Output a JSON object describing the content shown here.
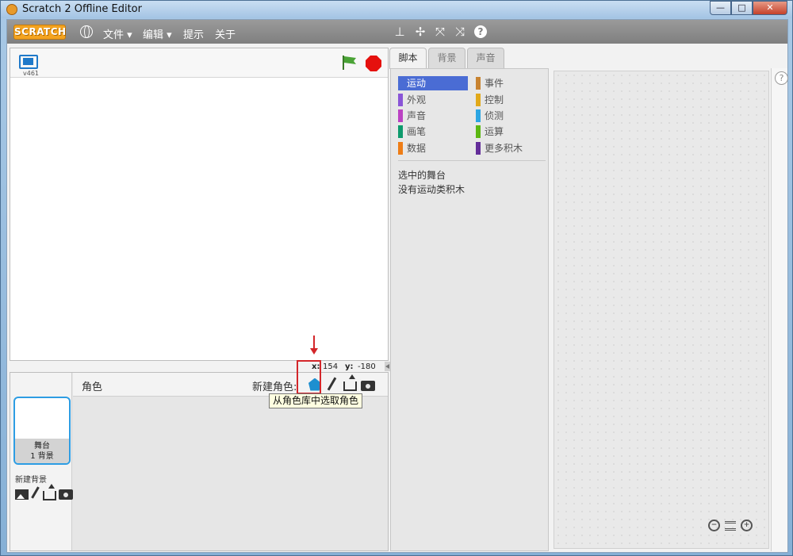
{
  "window": {
    "title": "Scratch 2 Offline Editor",
    "buttons": {
      "minimize": "—",
      "maximize": "□",
      "close": "✕"
    }
  },
  "menubar": {
    "logo": "SCRATCH",
    "items": [
      "文件 ▾",
      "编辑 ▾",
      "提示",
      "关于"
    ],
    "tools": [
      "stamp-icon",
      "cut-icon",
      "grow-icon",
      "shrink-icon",
      "help-icon"
    ],
    "help_label": "?"
  },
  "stage": {
    "version": "v461",
    "x_label": "x:",
    "x_value": "154",
    "y_label": "y:",
    "y_value": "-180"
  },
  "sprites": {
    "header": "角色",
    "new_sprite_label": "新建角色:",
    "tooltip": "从角色库中选取角色",
    "stage_thumb_name": "舞台",
    "stage_thumb_sub": "1 背景",
    "new_backdrop_label": "新建背景"
  },
  "tabs": [
    "脚本",
    "背景",
    "声音"
  ],
  "palette": {
    "categories_left": [
      {
        "label": "运动",
        "color": "#4a6cd4"
      },
      {
        "label": "外观",
        "color": "#8a55d7"
      },
      {
        "label": "声音",
        "color": "#bb42c3"
      },
      {
        "label": "画笔",
        "color": "#0e9a6c"
      },
      {
        "label": "数据",
        "color": "#ee7d16"
      }
    ],
    "categories_right": [
      {
        "label": "事件",
        "color": "#c88330"
      },
      {
        "label": "控制",
        "color": "#e1a91a"
      },
      {
        "label": "侦测",
        "color": "#2ca5e2"
      },
      {
        "label": "运算",
        "color": "#5cb712"
      },
      {
        "label": "更多积木",
        "color": "#632d99"
      }
    ],
    "selected_target": "选中的舞台",
    "no_blocks": "没有运动类积木"
  },
  "script_area": {
    "help": "?",
    "zoom_out": "−",
    "zoom_in": "+"
  }
}
